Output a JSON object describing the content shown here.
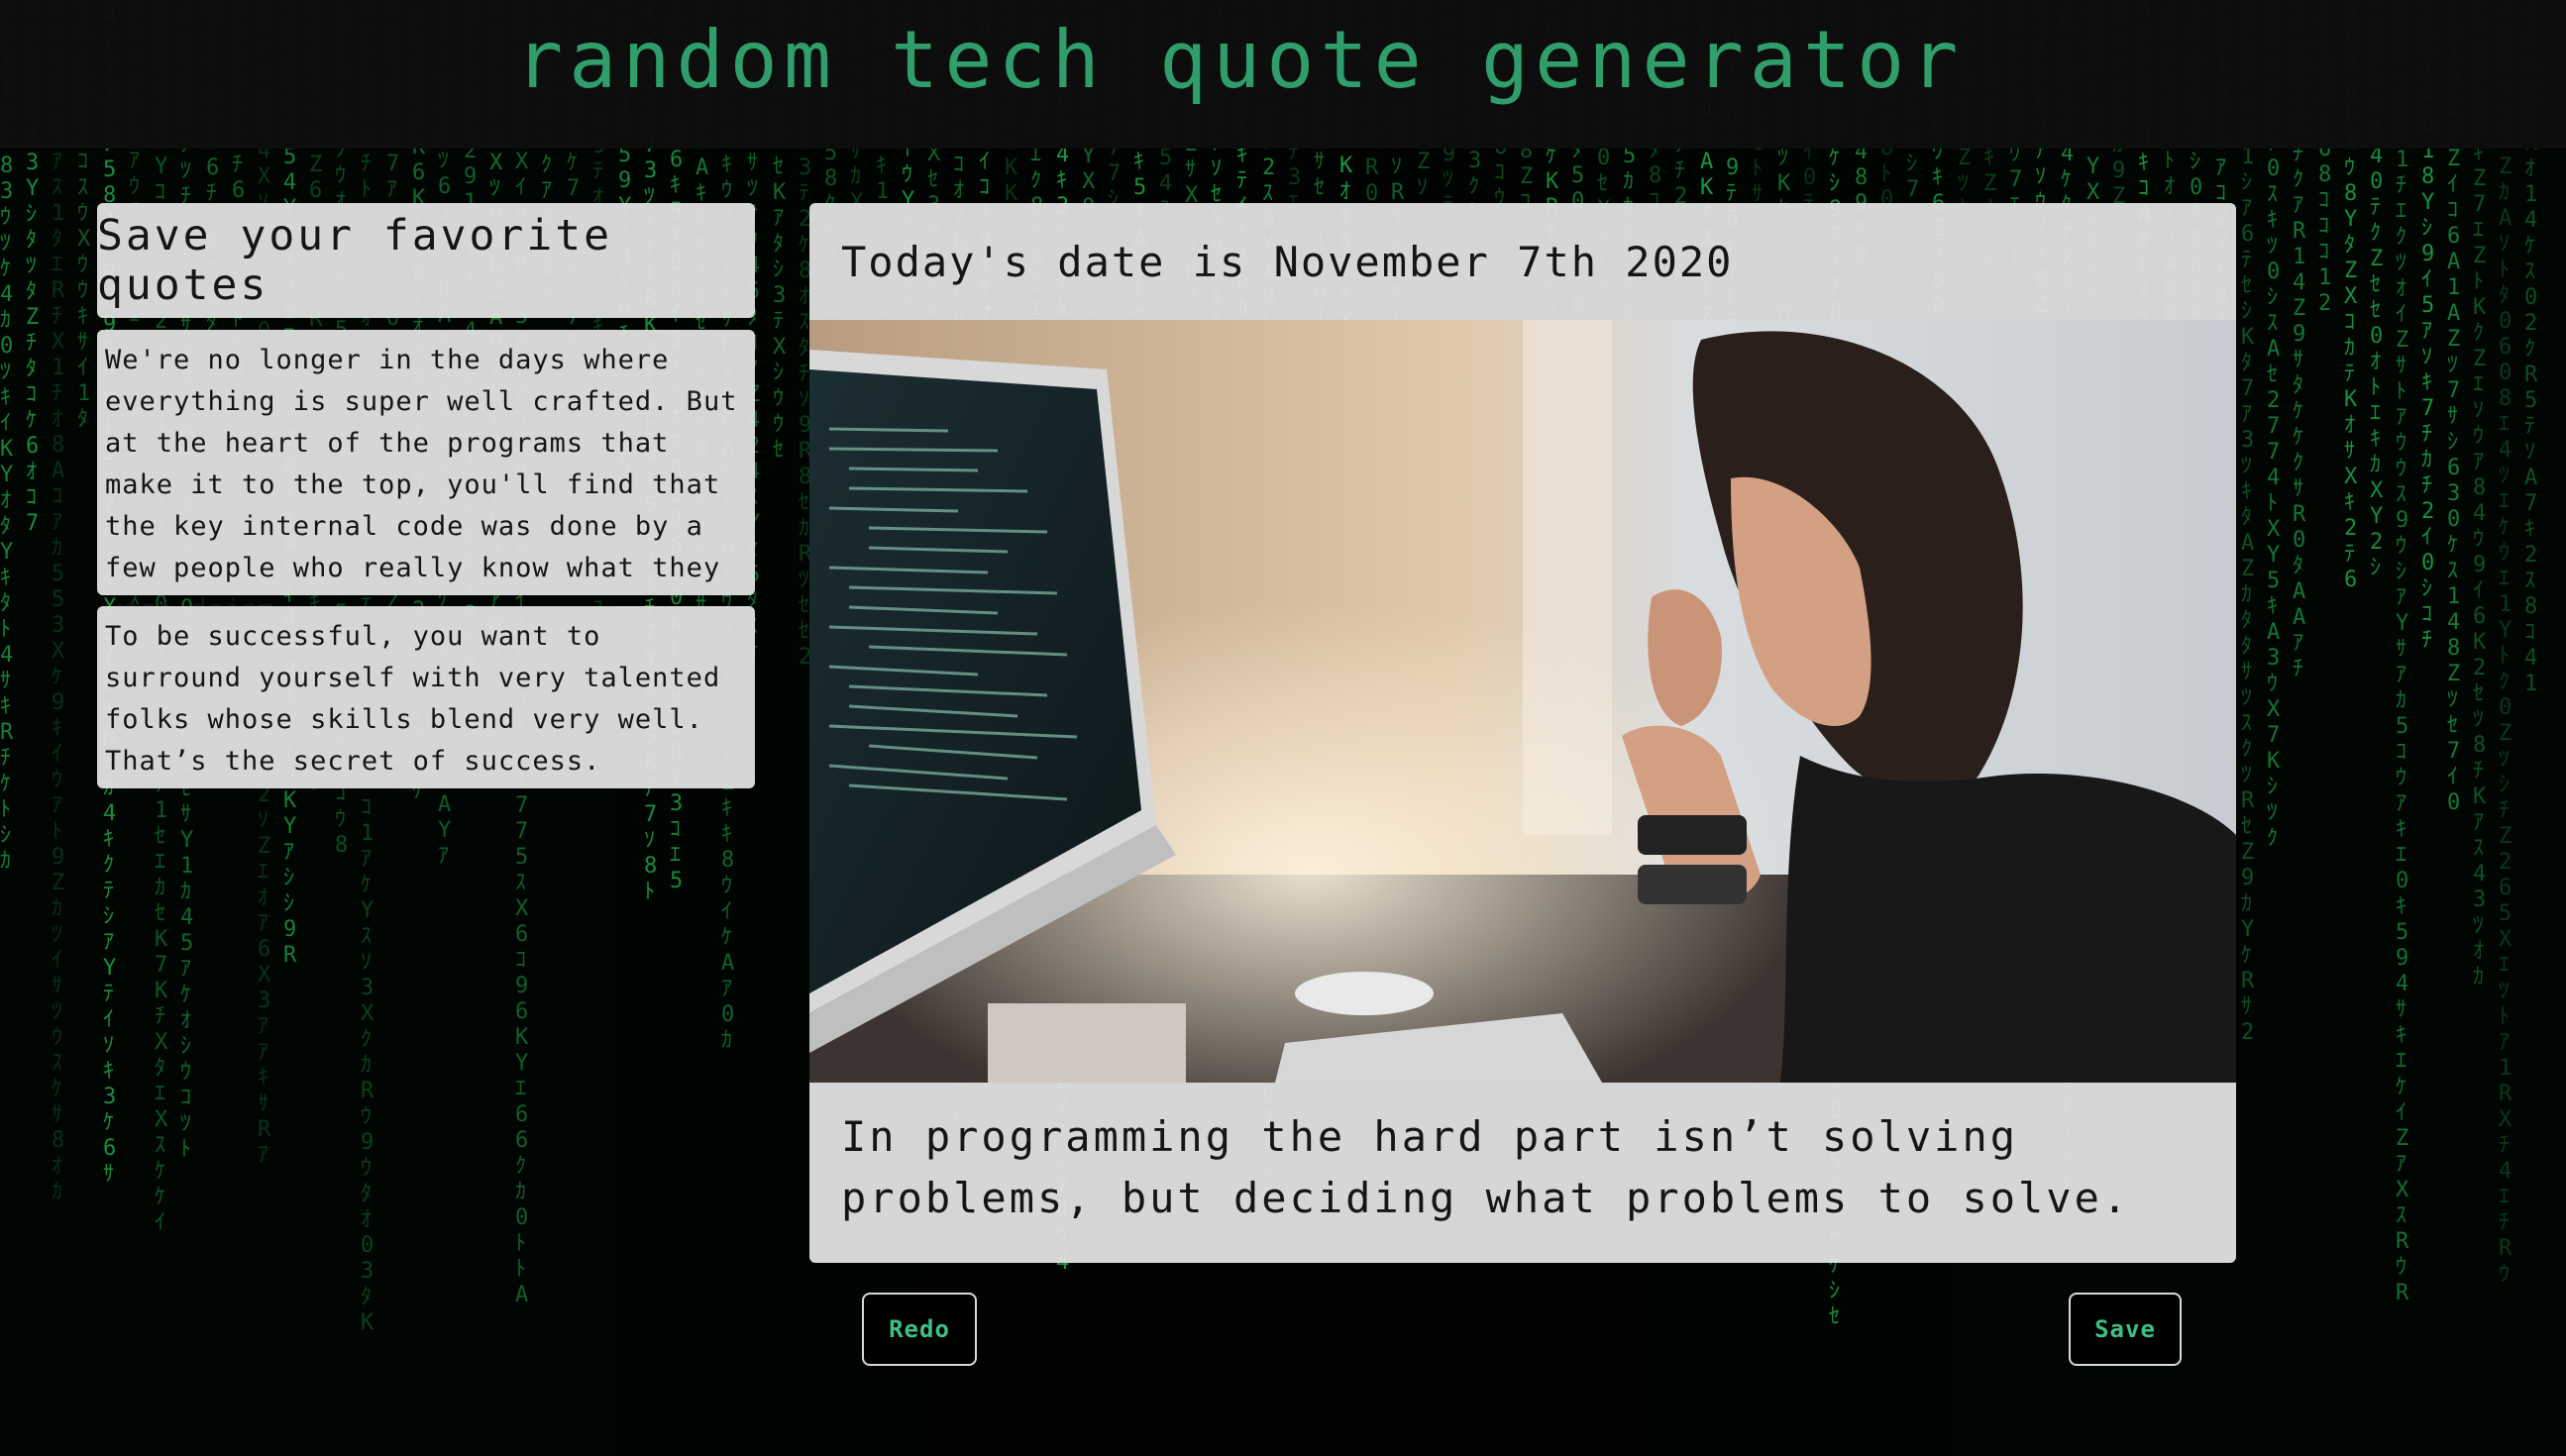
{
  "header": {
    "title": "random tech quote generator"
  },
  "saved": {
    "heading": "Save your favorite quotes",
    "quotes": [
      "We're no longer in the days where everything is super well crafted. But at the heart of the programs that make it to the top, you'll find that the key internal code was done by a few people who really know what they were doing.",
      "To be successful, you want to surround yourself with very talented folks whose skills blend very well. That’s the secret of success."
    ]
  },
  "main": {
    "date_text": "Today's date is November 7th 2020",
    "quote": "In programming the hard part isn’t solving problems, but deciding what problems to solve."
  },
  "buttons": {
    "redo": "Redo",
    "save": "Save"
  },
  "colors": {
    "accent": "#2f9e6a",
    "button_text": "#3fbf86",
    "rain": "#1fa84a",
    "panel": "#e2e2e2"
  }
}
